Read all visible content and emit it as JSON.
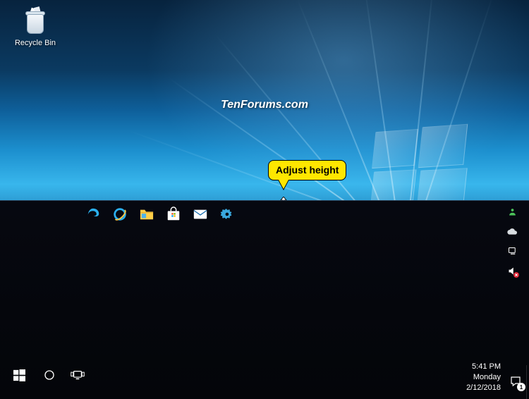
{
  "desktop_icons": {
    "recycle_bin": {
      "label": "Recycle Bin"
    }
  },
  "watermark_text": "TenForums.com",
  "callout_text": "Adjust height",
  "taskbar": {
    "pinned": [
      {
        "name": "edge"
      },
      {
        "name": "internet-explorer"
      },
      {
        "name": "file-explorer"
      },
      {
        "name": "microsoft-store"
      },
      {
        "name": "mail"
      },
      {
        "name": "settings-app"
      }
    ],
    "tray": [
      {
        "name": "meet-now"
      },
      {
        "name": "onedrive"
      },
      {
        "name": "network"
      },
      {
        "name": "volume"
      }
    ],
    "clock": {
      "time": "5:41 PM",
      "day": "Monday",
      "date": "2/12/2018"
    },
    "notifications": {
      "count": "1"
    }
  }
}
